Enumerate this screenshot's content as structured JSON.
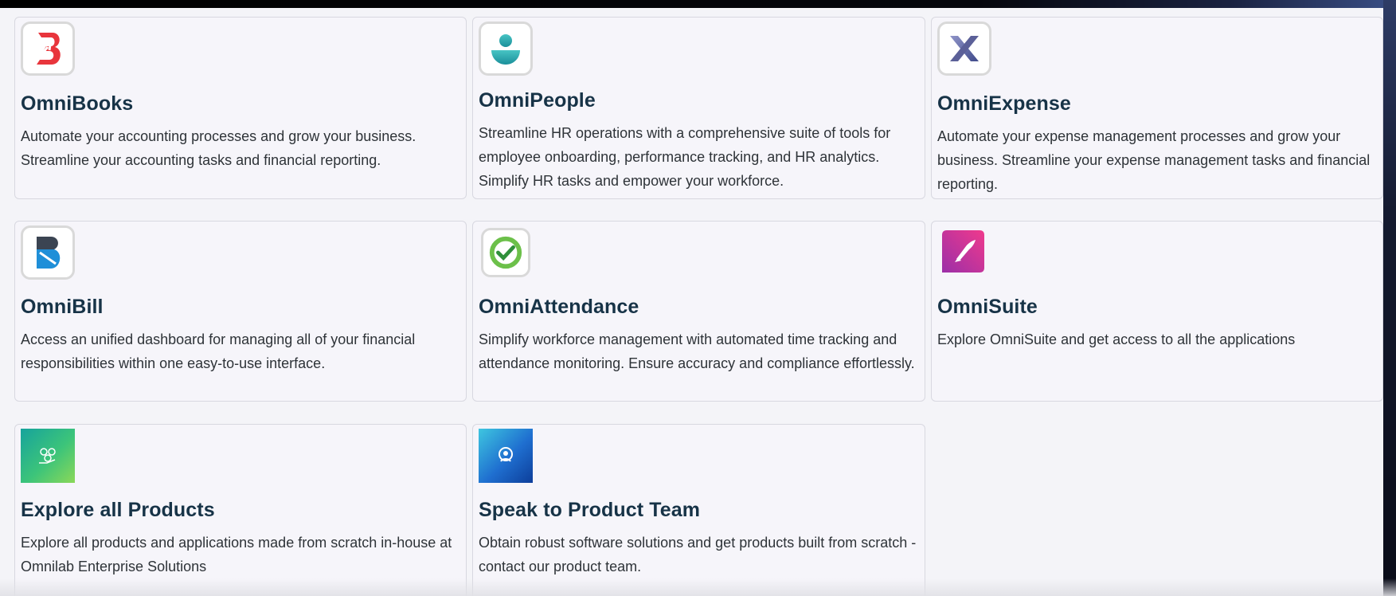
{
  "products": [
    {
      "key": "omnibooks",
      "title": "OmniBooks",
      "description": "Automate your accounting processes and grow your business. Streamline your accounting tasks and financial reporting.",
      "icon": "omnibooks-logo-icon"
    },
    {
      "key": "omnipeople",
      "title": "OmniPeople",
      "description": "Streamline HR operations with a comprehensive suite of tools for employee onboarding, performance tracking, and HR analytics. Simplify HR tasks and empower your workforce.",
      "icon": "omnipeople-logo-icon"
    },
    {
      "key": "omniexpense",
      "title": "OmniExpense",
      "description": "Automate your expense management processes and grow your business. Streamline your expense management tasks and financial reporting.",
      "icon": "omniexpense-logo-icon"
    },
    {
      "key": "omnibill",
      "title": "OmniBill",
      "description": "Access an unified dashboard for managing all of your financial responsibilities within one easy-to-use interface.",
      "icon": "omnibill-logo-icon"
    },
    {
      "key": "omniattendance",
      "title": "OmniAttendance",
      "description": "Simplify workforce management with automated time tracking and attendance monitoring. Ensure accuracy and compliance effortlessly.",
      "icon": "omniattendance-logo-icon"
    },
    {
      "key": "omnisuite",
      "title": "OmniSuite",
      "description": "Explore OmniSuite and get access to all the applications",
      "icon": "omnisuite-rocket-icon"
    },
    {
      "key": "explore",
      "title": "Explore all Products",
      "description": "Explore all products and applications made from scratch in-house at Omnilab Enterprise Solutions",
      "icon": "explore-products-icon"
    },
    {
      "key": "speak",
      "title": "Speak to Product Team",
      "description": "Obtain robust software solutions and get products built from scratch - contact our product team.",
      "icon": "support-agent-icon"
    }
  ],
  "colors": {
    "heading": "#173347",
    "body_text": "#2e3338",
    "card_bg": "#f6f5fa",
    "card_border": "#d8d8e0"
  }
}
